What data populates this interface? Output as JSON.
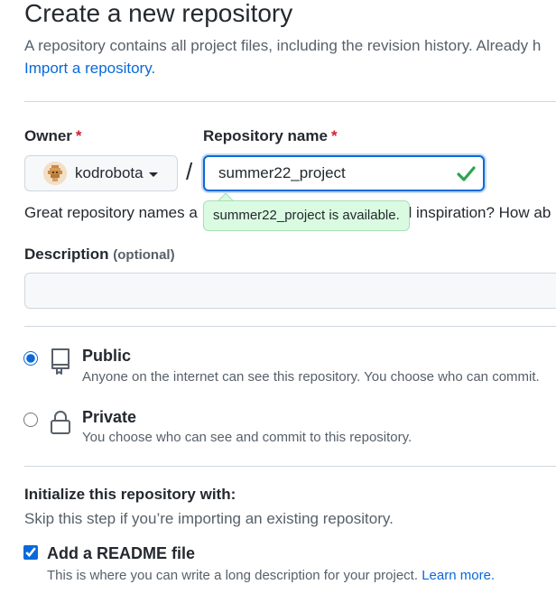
{
  "header": {
    "title": "Create a new repository",
    "subtitle": "A repository contains all project files, including the revision history. Already h",
    "import_link": "Import a repository."
  },
  "owner": {
    "label": "Owner",
    "required_mark": "*",
    "selected": "kodrobota"
  },
  "separator": "/",
  "repo_name": {
    "label": "Repository name",
    "required_mark": "*",
    "value": "summer22_project",
    "availability_message": "summer22_project is available."
  },
  "name_hint": {
    "before": "Great repository names a",
    "after": "d inspiration? How ab"
  },
  "description": {
    "label": "Description",
    "optional": "(optional)",
    "value": ""
  },
  "visibility": {
    "selected": "public",
    "options": [
      {
        "title": "Public",
        "desc": "Anyone on the internet can see this repository. You choose who can commit."
      },
      {
        "title": "Private",
        "desc": "You choose who can see and commit to this repository."
      }
    ]
  },
  "initialize": {
    "title": "Initialize this repository with:",
    "subtitle": "Skip this step if you’re importing an existing repository.",
    "readme": {
      "checked": true,
      "title": "Add a README file",
      "desc": "This is where you can write a long description for your project.",
      "link": "Learn more."
    }
  },
  "colors": {
    "accent": "#0969da",
    "success": "#2da44e",
    "required": "#cf222e"
  }
}
